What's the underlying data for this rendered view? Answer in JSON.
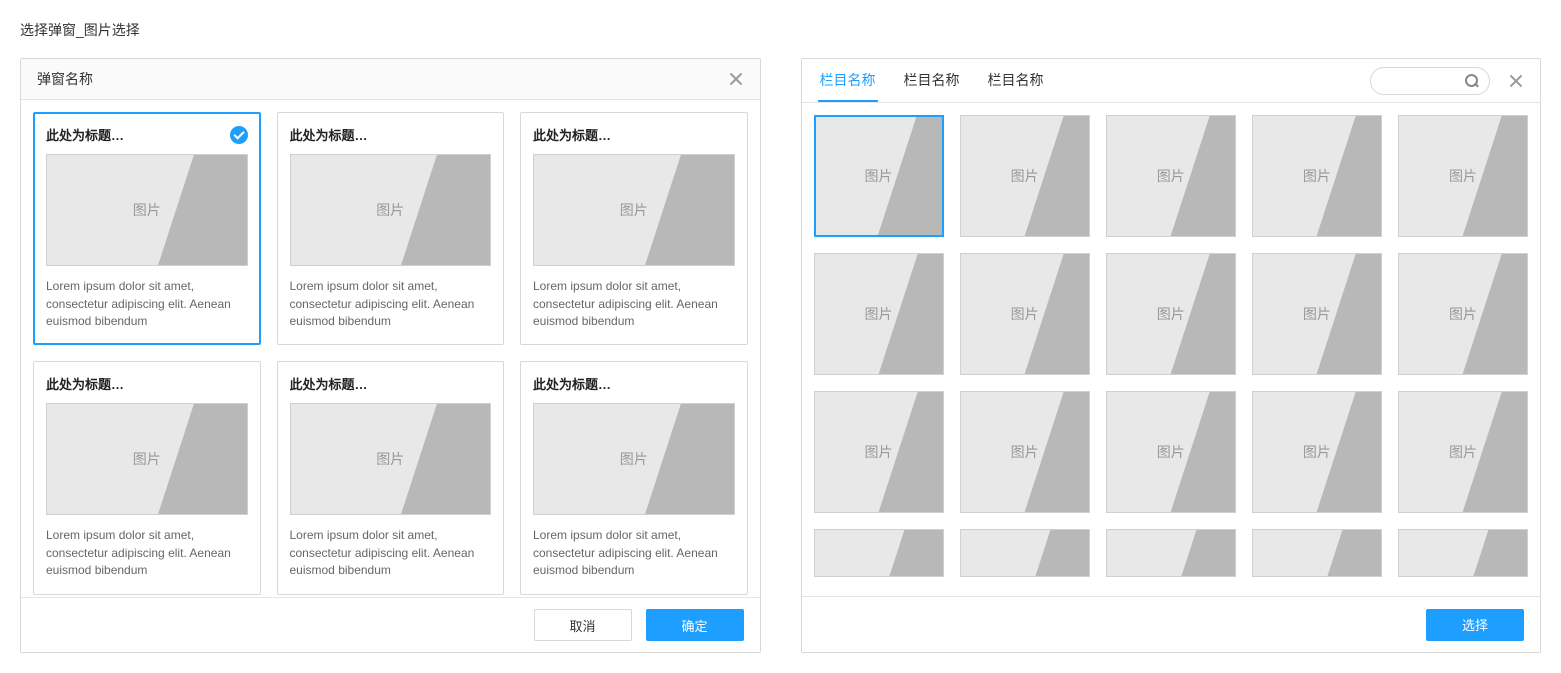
{
  "page_title": "选择弹窗_图片选择",
  "thumb_label": "图片",
  "left_panel": {
    "title": "弹窗名称",
    "cancel_label": "取消",
    "confirm_label": "确定",
    "cards": [
      {
        "title": "此处为标题…",
        "desc": "Lorem ipsum dolor sit amet, consectetur adipiscing elit. Aenean euismod bibendum",
        "selected": true
      },
      {
        "title": "此处为标题…",
        "desc": "Lorem ipsum dolor sit amet, consectetur adipiscing elit. Aenean euismod bibendum",
        "selected": false
      },
      {
        "title": "此处为标题…",
        "desc": "Lorem ipsum dolor sit amet, consectetur adipiscing elit. Aenean euismod bibendum",
        "selected": false
      },
      {
        "title": "此处为标题…",
        "desc": "Lorem ipsum dolor sit amet, consectetur adipiscing elit. Aenean euismod bibendum",
        "selected": false
      },
      {
        "title": "此处为标题…",
        "desc": "Lorem ipsum dolor sit amet, consectetur adipiscing elit. Aenean euismod bibendum",
        "selected": false
      },
      {
        "title": "此处为标题…",
        "desc": "Lorem ipsum dolor sit amet, consectetur adipiscing elit. Aenean euismod bibendum",
        "selected": false
      }
    ]
  },
  "right_panel": {
    "tabs": [
      {
        "label": "栏目名称",
        "active": true
      },
      {
        "label": "栏目名称",
        "active": false
      },
      {
        "label": "栏目名称",
        "active": false
      }
    ],
    "search_placeholder": "",
    "select_label": "选择",
    "rows": 4,
    "cols": 5,
    "selected_index": 0
  }
}
